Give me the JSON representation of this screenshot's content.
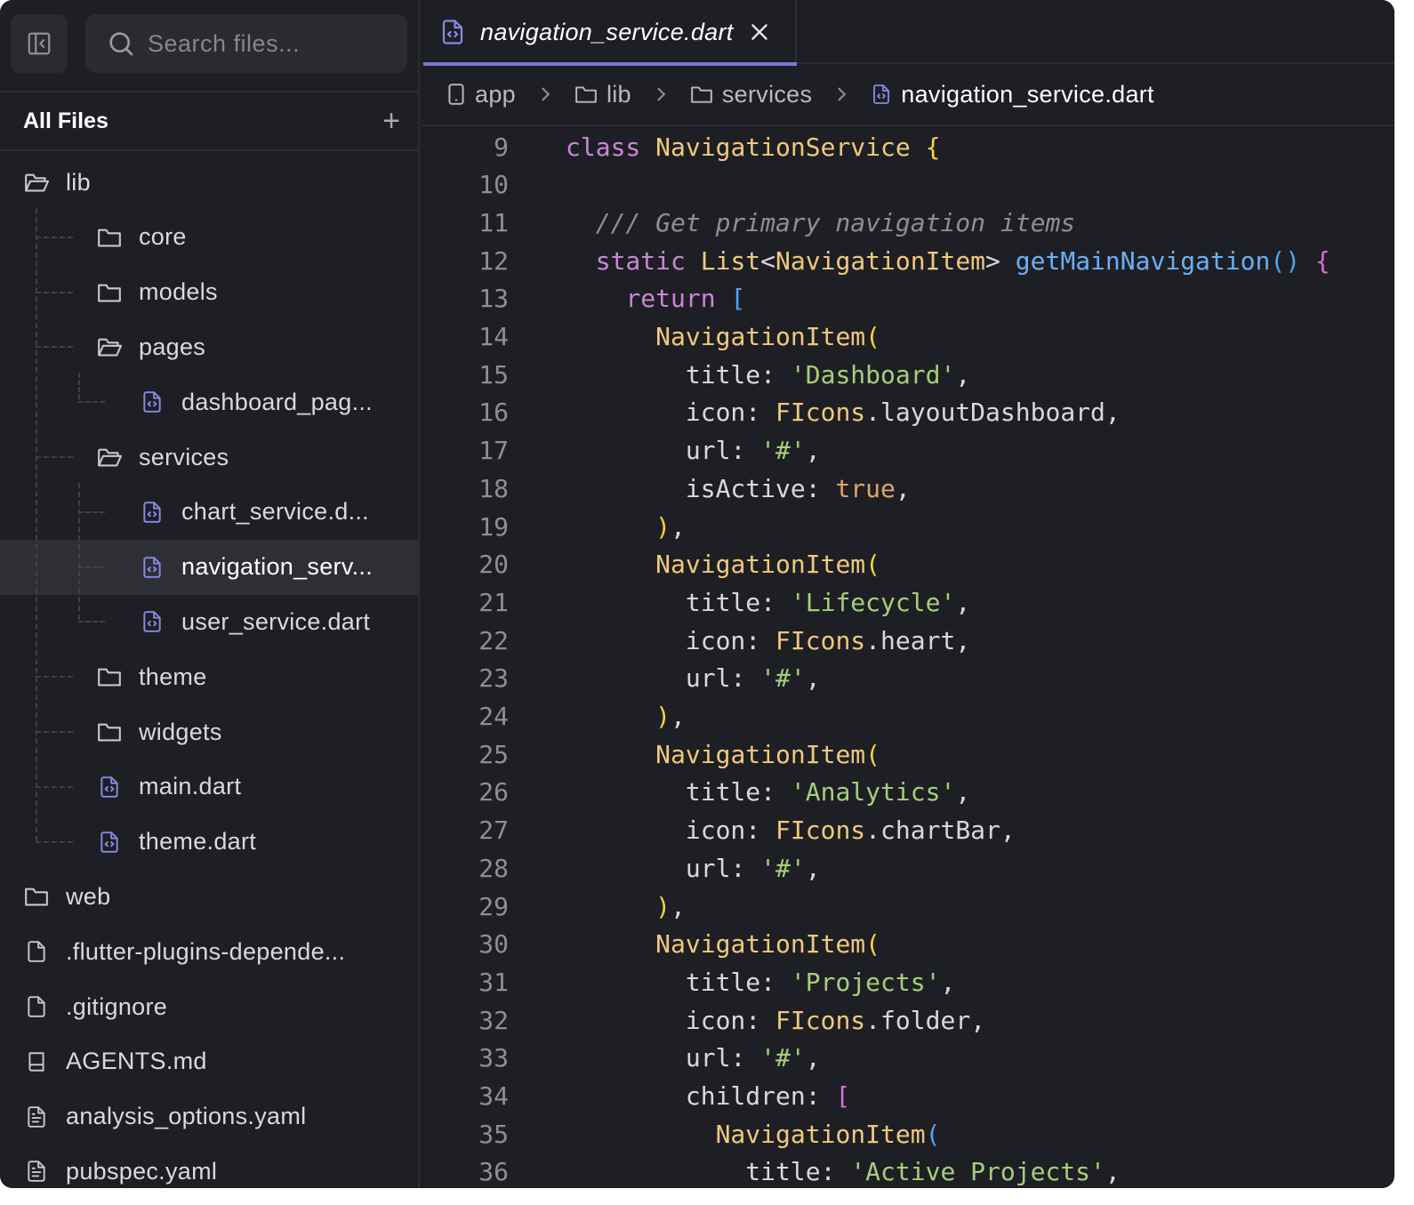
{
  "sidebar": {
    "search_placeholder": "Search files...",
    "header_title": "All Files",
    "add_label": "+",
    "items": [
      {
        "label": "lib",
        "icon": "folder-open-icon"
      },
      {
        "label": "core",
        "icon": "folder-icon"
      },
      {
        "label": "models",
        "icon": "folder-icon"
      },
      {
        "label": "pages",
        "icon": "folder-open-icon"
      },
      {
        "label": "dashboard_pag...",
        "icon": "dart-file-icon"
      },
      {
        "label": "services",
        "icon": "folder-open-icon"
      },
      {
        "label": "chart_service.d...",
        "icon": "dart-file-icon"
      },
      {
        "label": "navigation_serv...",
        "icon": "dart-file-icon",
        "active": true
      },
      {
        "label": "user_service.dart",
        "icon": "dart-file-icon"
      },
      {
        "label": "theme",
        "icon": "folder-icon"
      },
      {
        "label": "widgets",
        "icon": "folder-icon"
      },
      {
        "label": "main.dart",
        "icon": "dart-file-icon"
      },
      {
        "label": "theme.dart",
        "icon": "dart-file-icon"
      },
      {
        "label": "web",
        "icon": "folder-icon"
      },
      {
        "label": ".flutter-plugins-depende...",
        "icon": "file-icon"
      },
      {
        "label": ".gitignore",
        "icon": "file-icon"
      },
      {
        "label": "AGENTS.md",
        "icon": "book-icon"
      },
      {
        "label": "analysis_options.yaml",
        "icon": "text-file-icon"
      },
      {
        "label": "pubspec.yaml",
        "icon": "text-file-icon"
      }
    ]
  },
  "editor": {
    "tab": {
      "label": "navigation_service.dart",
      "close": "×"
    },
    "breadcrumb": [
      "app",
      "lib",
      "services",
      "navigation_service.dart"
    ],
    "lines": [
      {
        "n": "9",
        "t": "class NavigationService {"
      },
      {
        "n": "10",
        "t": ""
      },
      {
        "n": "11",
        "t": "  /// Get primary navigation items"
      },
      {
        "n": "12",
        "t": "  static List<NavigationItem> getMainNavigation() {"
      },
      {
        "n": "13",
        "t": "    return ["
      },
      {
        "n": "14",
        "t": "      NavigationItem("
      },
      {
        "n": "15",
        "t": "        title: 'Dashboard',"
      },
      {
        "n": "16",
        "t": "        icon: FIcons.layoutDashboard,"
      },
      {
        "n": "17",
        "t": "        url: '#',"
      },
      {
        "n": "18",
        "t": "        isActive: true,"
      },
      {
        "n": "19",
        "t": "      ),"
      },
      {
        "n": "20",
        "t": "      NavigationItem("
      },
      {
        "n": "21",
        "t": "        title: 'Lifecycle',"
      },
      {
        "n": "22",
        "t": "        icon: FIcons.heart,"
      },
      {
        "n": "23",
        "t": "        url: '#',"
      },
      {
        "n": "24",
        "t": "      ),"
      },
      {
        "n": "25",
        "t": "      NavigationItem("
      },
      {
        "n": "26",
        "t": "        title: 'Analytics',"
      },
      {
        "n": "27",
        "t": "        icon: FIcons.chartBar,"
      },
      {
        "n": "28",
        "t": "        url: '#',"
      },
      {
        "n": "29",
        "t": "      ),"
      },
      {
        "n": "30",
        "t": "      NavigationItem("
      },
      {
        "n": "31",
        "t": "        title: 'Projects',"
      },
      {
        "n": "32",
        "t": "        icon: FIcons.folder,"
      },
      {
        "n": "33",
        "t": "        url: '#',"
      },
      {
        "n": "34",
        "t": "        children: ["
      },
      {
        "n": "35",
        "t": "          NavigationItem("
      },
      {
        "n": "36",
        "t": "            title: 'Active Projects',"
      }
    ]
  },
  "colors": {
    "background": "#1e1f24",
    "accent": "#7a76d8",
    "keyword": "#c986d7",
    "class": "#f0c97a",
    "function": "#6ab0f3",
    "string": "#a5cf7a",
    "comment": "#8d8f96"
  }
}
